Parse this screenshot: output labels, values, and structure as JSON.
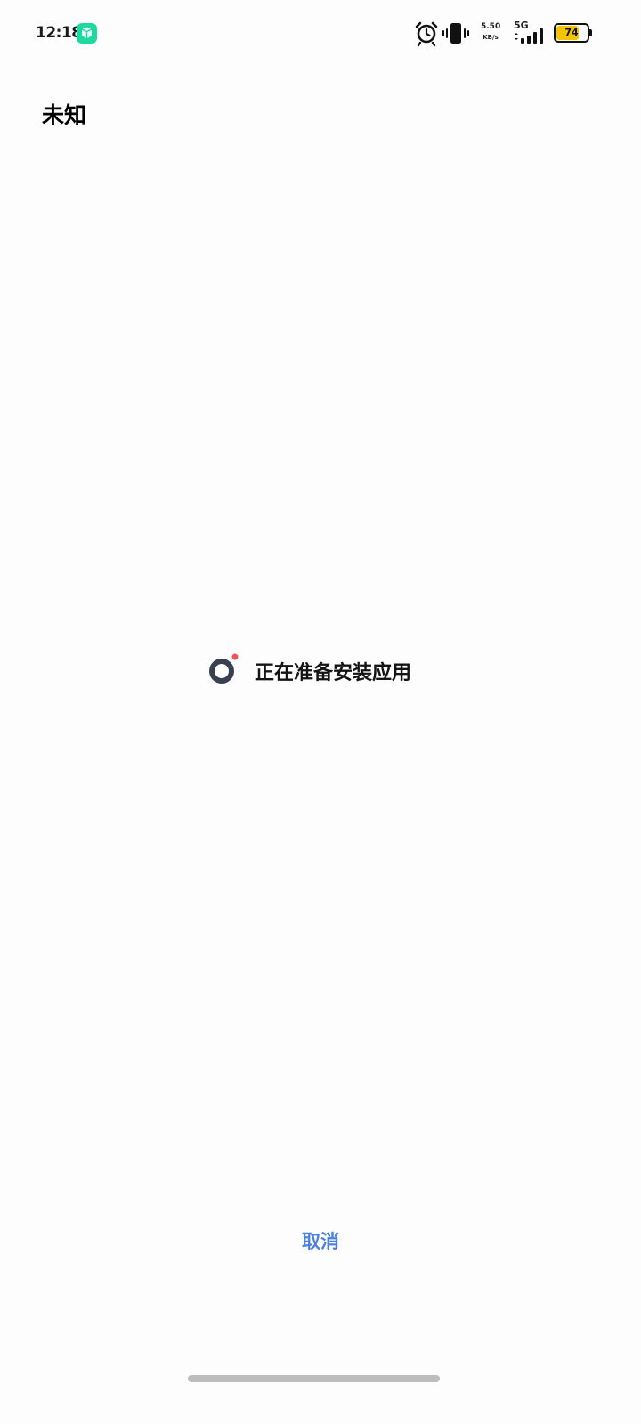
{
  "status_bar": {
    "time": "12:18",
    "app_icon": "green-app-notification-icon",
    "alarm_icon": "alarm-clock-icon",
    "vibrate_icon": "vibrate-icon",
    "net_speed_rate": "5.50",
    "net_speed_unit": "KB/s",
    "network_type": "5G",
    "signal_icon": "signal-bars-icon",
    "battery_level": "74",
    "battery_fraction": 0.74,
    "battery_color": "#f5c400"
  },
  "page": {
    "title": "未知",
    "status_icon": "loading-spinner-icon",
    "status_text": "正在准备安装应用",
    "cancel_label": "取消"
  },
  "colors": {
    "accent": "#4a80e0",
    "spinner_dot": "#f0525e",
    "spinner_ring": "#3a3f52"
  }
}
